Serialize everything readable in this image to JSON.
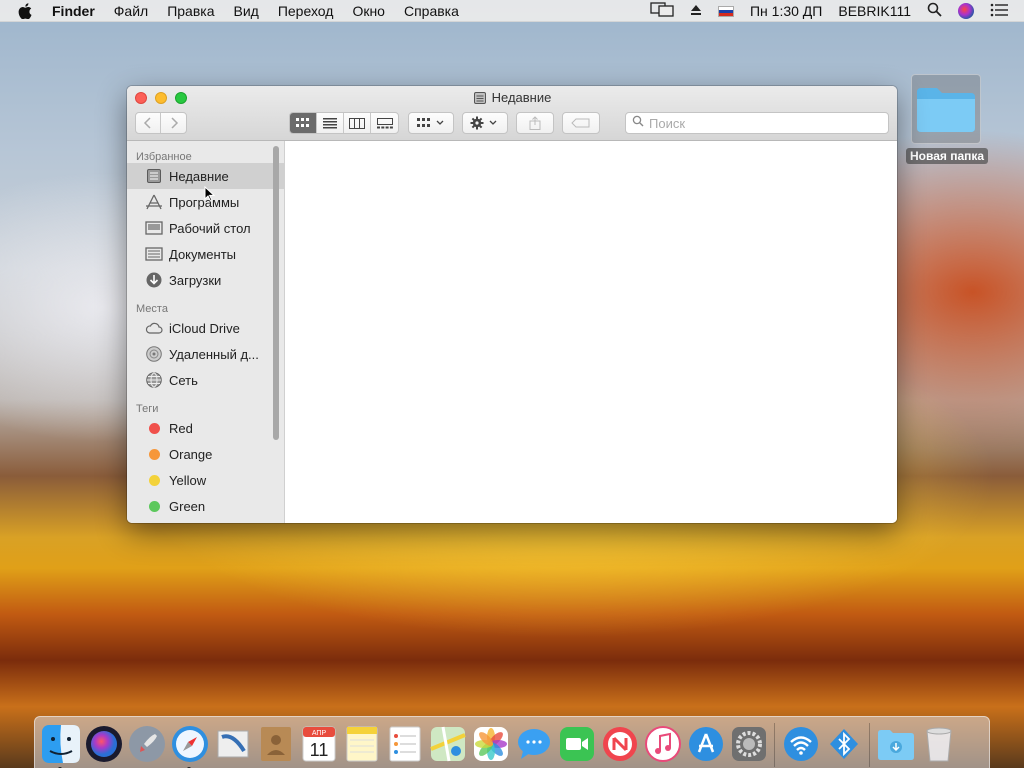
{
  "menubar": {
    "app_name": "Finder",
    "menus": [
      "Файл",
      "Правка",
      "Вид",
      "Переход",
      "Окно",
      "Справка"
    ],
    "clock": "Пн 1:30 ДП",
    "user": "BEBRIK111"
  },
  "desktop": {
    "folder_label": "Новая папка"
  },
  "window": {
    "title": "Недавние",
    "search_placeholder": "Поиск",
    "view_modes": [
      "icon-view",
      "list-view",
      "column-view",
      "gallery-view"
    ],
    "active_view": "icon-view"
  },
  "sidebar": {
    "favorites_header": "Избранное",
    "favorites": [
      {
        "label": "Недавние",
        "icon": "recents-icon",
        "selected": true
      },
      {
        "label": "Программы",
        "icon": "applications-icon"
      },
      {
        "label": "Рабочий стол",
        "icon": "desktop-icon"
      },
      {
        "label": "Документы",
        "icon": "documents-icon"
      },
      {
        "label": "Загрузки",
        "icon": "downloads-icon"
      }
    ],
    "locations_header": "Места",
    "locations": [
      {
        "label": "iCloud Drive",
        "icon": "icloud-icon"
      },
      {
        "label": "Удаленный д...",
        "icon": "remote-disc-icon"
      },
      {
        "label": "Сеть",
        "icon": "network-icon"
      }
    ],
    "tags_header": "Теги",
    "tags": [
      {
        "label": "Red",
        "color": "#f0504b"
      },
      {
        "label": "Orange",
        "color": "#f6973a"
      },
      {
        "label": "Yellow",
        "color": "#f3d23a"
      },
      {
        "label": "Green",
        "color": "#5cc85c"
      }
    ]
  },
  "dock": {
    "apps": [
      "finder-icon",
      "siri-icon",
      "launchpad-icon",
      "safari-icon",
      "mail-icon",
      "contacts-icon",
      "calendar-icon",
      "notes-icon",
      "reminders-icon",
      "maps-icon",
      "photos-icon",
      "messages-icon",
      "facetime-icon",
      "news-icon",
      "itunes-icon",
      "app-store-icon",
      "system-preferences-icon"
    ],
    "extras": [
      "wifi-icon",
      "bluetooth-icon"
    ],
    "right": [
      "downloads-stack-icon",
      "trash-icon"
    ],
    "calendar_month": "АПР",
    "calendar_day": "11"
  }
}
